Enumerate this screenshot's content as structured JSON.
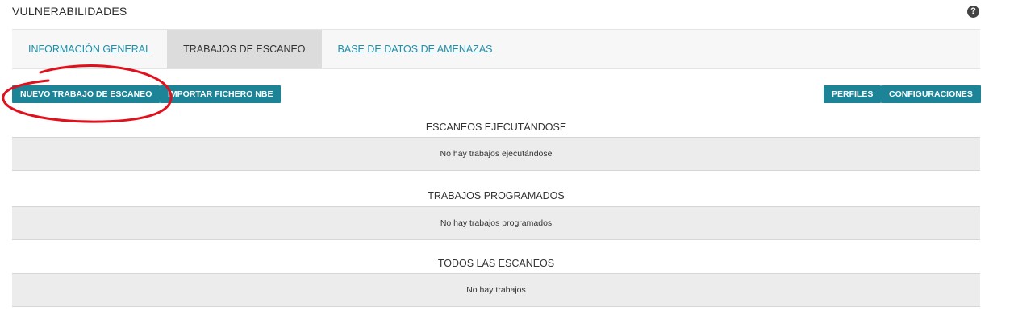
{
  "header": {
    "title": "VULNERABILIDADES",
    "help_icon": "?"
  },
  "tabs": [
    {
      "label": "INFORMACIÓN GENERAL",
      "active": false
    },
    {
      "label": "TRABAJOS DE ESCANEO",
      "active": true
    },
    {
      "label": "BASE DE DATOS DE AMENAZAS",
      "active": false
    }
  ],
  "toolbar": {
    "new_scan_job": "NUEVO TRABAJO DE ESCANEO",
    "import_nbe": "IMPORTAR FICHERO NBE",
    "profiles": "PERFILES",
    "configurations": "CONFIGURACIONES"
  },
  "sections": {
    "running": {
      "title": "ESCANEOS EJECUTÁNDOSE",
      "empty": "No hay trabajos ejecutándose"
    },
    "scheduled": {
      "title": "TRABAJOS PROGRAMADOS",
      "empty": "No hay trabajos programados"
    },
    "all": {
      "title": "TODOS LAS ESCANEOS",
      "empty": "No hay trabajos"
    }
  },
  "colors": {
    "accent": "#1d8396",
    "tab_link": "#1f8fa8",
    "annotation": "#e0101c"
  }
}
